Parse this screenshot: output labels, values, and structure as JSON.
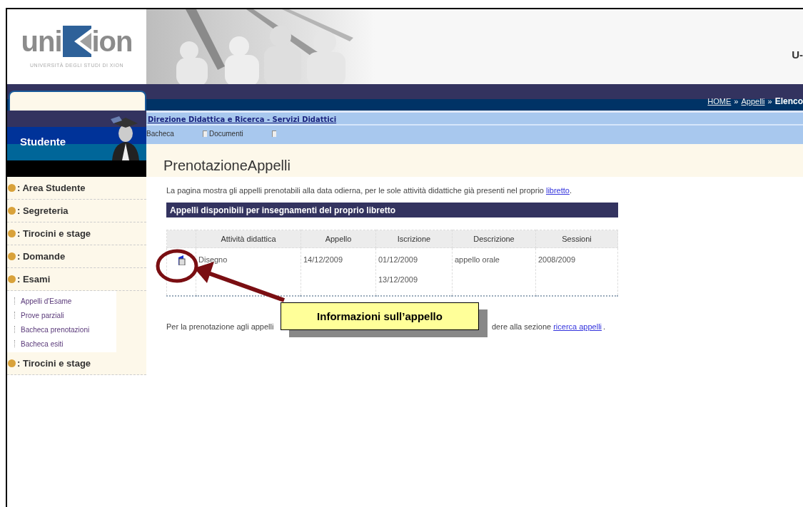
{
  "header": {
    "logo": {
      "start": "uni",
      "end": "ion",
      "subtitle": "UNIVERSITÀ DEGLI STUDI DI XION"
    },
    "right_text": "U-"
  },
  "breadcrumb": [
    {
      "kind": "link",
      "text": "HOME"
    },
    {
      "kind": "sep",
      "text": "»"
    },
    {
      "kind": "link",
      "text": "Appelli"
    },
    {
      "kind": "sep",
      "text": "»"
    },
    {
      "kind": "current",
      "text": "Elenco"
    }
  ],
  "sidebar": {
    "title": "Studente",
    "sections": [
      {
        "label": ": Area Studente"
      },
      {
        "label": ": Segreteria"
      },
      {
        "label": ": Tirocini e stage"
      },
      {
        "label": ": Domande"
      },
      {
        "label": ": Esami",
        "children": [
          "Appelli d'Esame",
          "Prove parziali",
          "Bacheca prenotazioni",
          "Bacheca esiti"
        ]
      },
      {
        "label": ": Tirocini e stage"
      }
    ]
  },
  "main": {
    "department_link": "Direzione Didattica e Ricerca - Servizi Didattici",
    "toolbar": [
      {
        "kind": "text",
        "label": "Bacheca"
      },
      {
        "kind": "icon-link",
        "label": "Documenti"
      },
      {
        "kind": "icon"
      }
    ],
    "page_title": "PrenotazioneAppelli",
    "intro": {
      "text": "La pagina mostra gli appelli prenotabili alla data odierna, per le sole attività didattiche già presenti nel proprio",
      "link": "libretto",
      "end": "."
    },
    "section_header": "Appelli disponibili per insegnamenti del proprio libretto",
    "table": {
      "columns": [
        "Attività didattica",
        "Appello",
        "Iscrizione",
        "Descrizione",
        "Sessioni"
      ],
      "rows": [
        {
          "activity": "Disegno",
          "appello": "14/12/2009",
          "iscrizione": [
            "01/12/2009",
            "13/12/2009"
          ],
          "descrizione": "appello orale",
          "sessioni": "2008/2009"
        }
      ]
    },
    "footer_note": {
      "before": "Per la prenotazione agli appelli",
      "after": "dere alla sezione",
      "link": "ricerca appelli",
      "end": "."
    }
  },
  "callout": {
    "text": "Informazioni sull’appello"
  }
}
